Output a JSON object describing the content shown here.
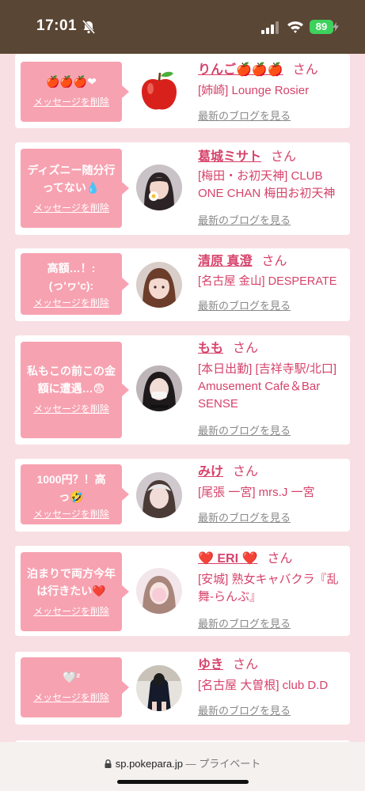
{
  "status_bar": {
    "time": "17:01",
    "battery": "89"
  },
  "delete_label": "メッセージを削除",
  "san_label": "さん",
  "blog_label": "最新のブログを見る",
  "entries": [
    {
      "name": "りんご🍎🍎🍎",
      "shop": "[姉崎] Lounge Rosier",
      "message": "🍎🍎🍎❤"
    },
    {
      "name": "葛城ミサト",
      "shop": "[梅田・お初天神] CLUB ONE CHAN 梅田お初天神",
      "message": "ディズニー随分行ってない💧"
    },
    {
      "name": "清原 真澄",
      "shop": "[名古屋 金山] DESPERATE",
      "message": "高額…！:(っ'ヮ'c):"
    },
    {
      "name": "もも",
      "shop": "[本日出勤] [吉祥寺駅/北口] Amusement Cafe＆Bar SENSE",
      "message": "私もこの前この金額に遭遇…😨"
    },
    {
      "name": "みけ",
      "shop": "[尾張 一宮] mrs.J 一宮",
      "message": "1000円？！高っ🤣"
    },
    {
      "name": "❤️ ERI ❤️",
      "shop": "[安城] 熟女キャバクラ『乱舞-らんぶ』",
      "message": "泊まりで両方今年は行きたい❤️"
    },
    {
      "name": "ゆき",
      "shop": "[名古屋 大曽根] club D.D",
      "message": "🤍²"
    }
  ],
  "browser": {
    "domain": "sp.pokepara.jp",
    "privacy": "— プライベート"
  }
}
